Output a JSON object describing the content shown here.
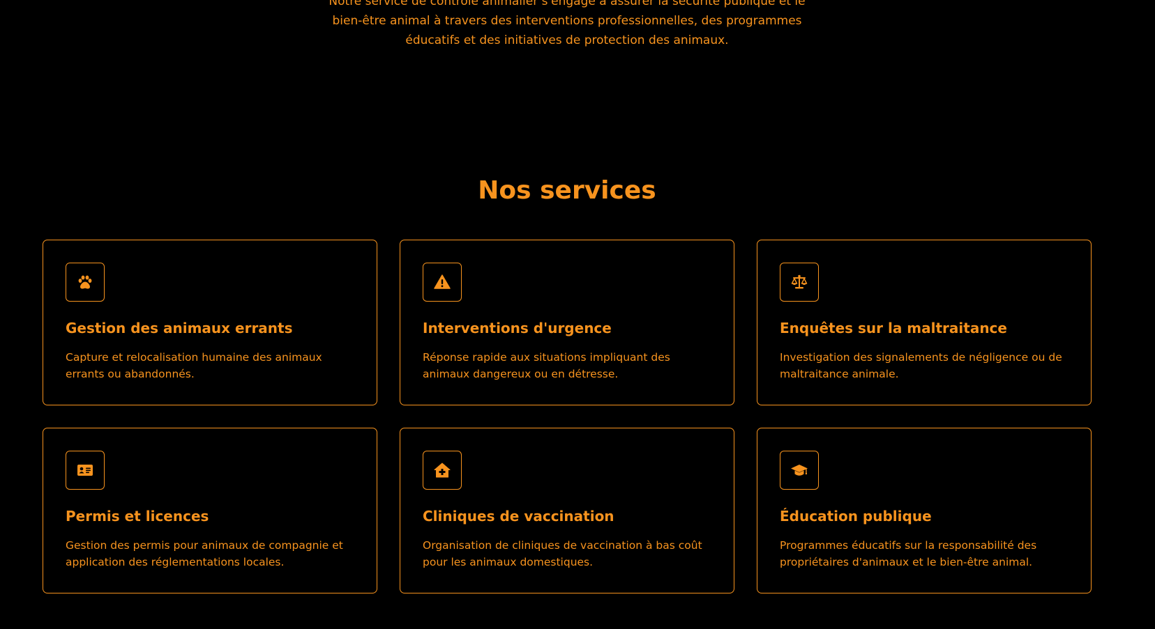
{
  "intro": {
    "lines": [
      "Notre service de contrôle animalier s'engage à assurer la sécurité publique et le",
      "bien-être animal à travers des interventions professionnelles, des programmes",
      "éducatifs et des initiatives de protection des animaux."
    ]
  },
  "services": {
    "title": "Nos services",
    "cards": [
      {
        "icon": "paw-icon",
        "title": "Gestion des animaux errants",
        "description": "Capture et relocalisation humaine des animaux errants ou abandonnés."
      },
      {
        "icon": "warning-icon",
        "title": "Interventions d'urgence",
        "description": "Réponse rapide aux situations impliquant des animaux dangereux ou en détresse."
      },
      {
        "icon": "scale-icon",
        "title": "Enquêtes sur la maltraitance",
        "description": "Investigation des signalements de négligence ou de maltraitance animale."
      },
      {
        "icon": "id-card-icon",
        "title": "Permis et licences",
        "description": "Gestion des permis pour animaux de compagnie et application des réglementations locales."
      },
      {
        "icon": "clinic-icon",
        "title": "Cliniques de vaccination",
        "description": "Organisation de cliniques de vaccination à bas coût pour les animaux domestiques."
      },
      {
        "icon": "graduation-cap-icon",
        "title": "Éducation publique",
        "description": "Programmes éducatifs sur la responsabilité des propriétaires d'animaux et le bien-être animal."
      }
    ]
  },
  "colors": {
    "accent": "#f7931e",
    "background": "#000000"
  }
}
